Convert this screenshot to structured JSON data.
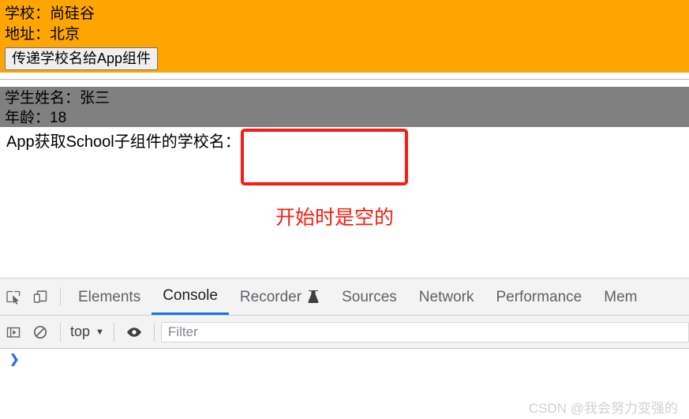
{
  "page": {
    "school_panel": {
      "school_label": "学校：尚硅谷",
      "address_label": "地址：北京",
      "button_label": "传递学校名给App组件",
      "bg_color": "#FFA500"
    },
    "student_panel": {
      "name_label": "学生姓名：张三",
      "age_label": "年龄：18",
      "bg_color": "#808080"
    },
    "app_row": {
      "label": "App获取School子组件的学校名：",
      "value": ""
    },
    "annotation": {
      "text": "开始时是空的",
      "color": "#f51d11"
    }
  },
  "devtools": {
    "icons": {
      "inspect": "inspect-element-icon",
      "device": "device-toolbar-icon",
      "sidebar": "console-sidebar-icon",
      "clear": "clear-console-icon",
      "eye": "live-expression-eye-icon",
      "recorder_flask": "flask-icon"
    },
    "tabs": [
      {
        "label": "Elements",
        "active": false
      },
      {
        "label": "Console",
        "active": true
      },
      {
        "label": "Recorder",
        "active": false,
        "icon": "flask-icon"
      },
      {
        "label": "Sources",
        "active": false
      },
      {
        "label": "Network",
        "active": false
      },
      {
        "label": "Performance",
        "active": false
      },
      {
        "label": "Mem",
        "active": false
      }
    ],
    "toolbar": {
      "context": "top",
      "context_caret": "▼",
      "filter_value": "",
      "filter_placeholder": "Filter"
    },
    "console": {
      "prompt": "❯"
    },
    "accent_color": "#1a73e8"
  },
  "watermark": {
    "text": "CSDN @我会努力变强的"
  }
}
